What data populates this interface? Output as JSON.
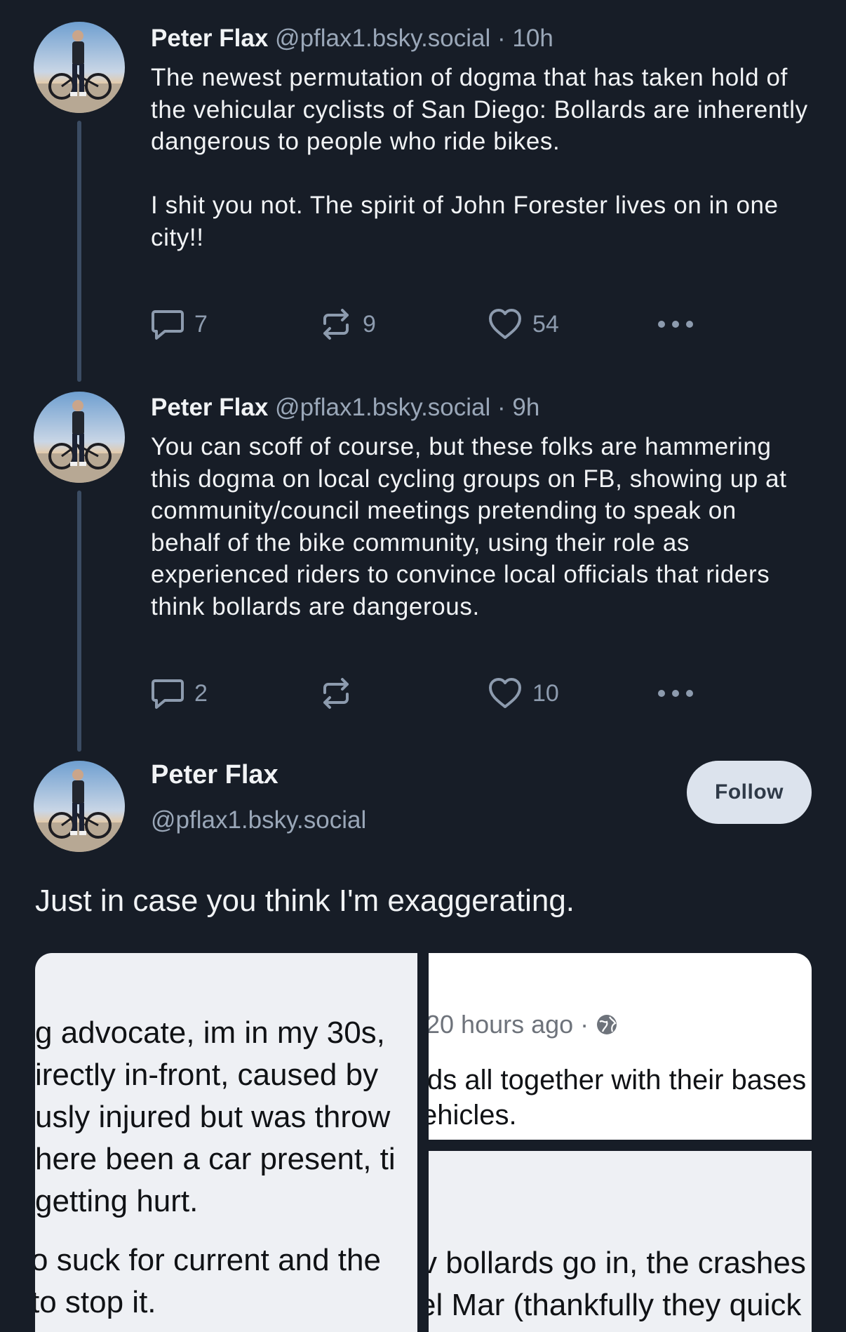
{
  "posts": [
    {
      "author_name": "Peter Flax",
      "handle": "@pflax1.bsky.social",
      "time": " · 10h",
      "text": "The newest permutation of dogma that has taken hold of the vehicular cyclists of San Diego: Bollards are inherently dangerous to people who ride bikes.\n\nI shit you not. The spirit of John Forester lives on in one city!!",
      "replies": "7",
      "reposts": "9",
      "likes": "54"
    },
    {
      "author_name": "Peter Flax",
      "handle": "@pflax1.bsky.social",
      "time": " · 9h",
      "text": "You can scoff of course, but these folks are hammering this dogma on local cycling groups on FB, showing up at community/council meetings pretending to speak on behalf of the bike community, using their role as experienced riders to convince local officials that riders think bollards are dangerous.",
      "replies": "2",
      "reposts": "",
      "likes": "10"
    }
  ],
  "main_post": {
    "author_name": "Peter Flax",
    "handle": "@pflax1.bsky.social",
    "follow_label": "Follow",
    "text": "Just in case you think I'm exaggerating."
  },
  "images": {
    "left": [
      "g advocate, im in my 30s,",
      "irectly in-front, caused by",
      "usly injured but was throw",
      "here been a car present, ti",
      "getting hurt.",
      "o suck for current and the",
      " to stop it."
    ],
    "right_top_meta": "20 hours ago ·",
    "right_top": [
      "ds all together with their bases",
      "ehicles."
    ],
    "right_bottom": [
      "v bollards go in, the crashes",
      "el Mar (thankfully they quick"
    ]
  },
  "icons": {
    "reply": "reply-icon",
    "repost": "repost-icon",
    "like": "heart-icon",
    "more": "more-icon",
    "globe": "globe-icon"
  },
  "colors": {
    "background": "#171d27",
    "muted_text": "#9aa7b8",
    "thread_line": "#3b4c63",
    "follow_button": "#dce3ed"
  }
}
